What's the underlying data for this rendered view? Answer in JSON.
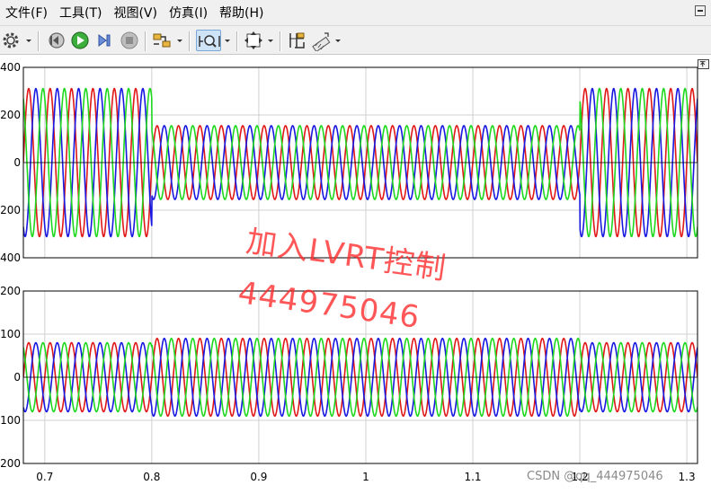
{
  "menu": {
    "items": [
      {
        "label": "文件(F)"
      },
      {
        "label": "工具(T)"
      },
      {
        "label": "视图(V)"
      },
      {
        "label": "仿真(I)"
      },
      {
        "label": "帮助(H)"
      }
    ]
  },
  "toolbar": {
    "icons": [
      "gear-icon",
      "step-back-icon",
      "run-icon",
      "step-forward-icon",
      "stop-icon",
      "signal-selector-icon",
      "zoom-icon",
      "autoscale-icon",
      "cursor-measure-icon",
      "signal-statistics-icon"
    ]
  },
  "colors": {
    "phase_a": "#e01818",
    "phase_b": "#1818e0",
    "phase_c": "#1ed81e",
    "grid": "#d0d0d0"
  },
  "watermark": {
    "line1": "加入LVRT控制",
    "line2": "444975046"
  },
  "credit": "CSDN @qq_444975046",
  "chart_data": [
    {
      "type": "line",
      "title": "",
      "xlabel": "",
      "ylabel": "",
      "xlim": [
        0.68,
        1.31
      ],
      "ylim": [
        -400,
        400
      ],
      "yticks": [
        400,
        200,
        0,
        -200,
        -400
      ],
      "ytick_labels": [
        "400",
        "200",
        "0",
        "200",
        "400"
      ],
      "grid": true,
      "frequency_hz": 50,
      "series": [
        {
          "color": "#e01818",
          "phase_deg": 0
        },
        {
          "color": "#1818e0",
          "phase_deg": -120
        },
        {
          "color": "#1ed81e",
          "phase_deg": 120
        }
      ],
      "amplitude_segments": [
        {
          "x": [
            0.68,
            0.8
          ],
          "amplitude": 311
        },
        {
          "x": [
            0.8,
            1.2
          ],
          "amplitude": 155
        },
        {
          "x": [
            1.2,
            1.31
          ],
          "amplitude": 311
        }
      ]
    },
    {
      "type": "line",
      "title": "",
      "xlabel": "",
      "ylabel": "",
      "xlim": [
        0.68,
        1.31
      ],
      "ylim": [
        -200,
        200
      ],
      "yticks": [
        200,
        100,
        0,
        -100,
        -200
      ],
      "ytick_labels": [
        "200",
        "100",
        "0",
        "-100",
        "-200"
      ],
      "xticks": [
        0.7,
        0.8,
        0.9,
        1.0,
        1.1,
        1.2,
        1.3
      ],
      "xtick_labels": [
        "0.7",
        "0.8",
        "0.9",
        "1",
        "1.1",
        "1.2",
        "1.3"
      ],
      "grid": true,
      "frequency_hz": 50,
      "series": [
        {
          "color": "#e01818",
          "phase_deg": 0
        },
        {
          "color": "#1818e0",
          "phase_deg": -120
        },
        {
          "color": "#1ed81e",
          "phase_deg": 120
        }
      ],
      "amplitude_segments": [
        {
          "x": [
            0.68,
            0.8
          ],
          "amplitude": 80
        },
        {
          "x": [
            0.8,
            1.2
          ],
          "amplitude": 90
        },
        {
          "x": [
            1.2,
            1.31
          ],
          "amplitude": 80
        }
      ]
    }
  ]
}
